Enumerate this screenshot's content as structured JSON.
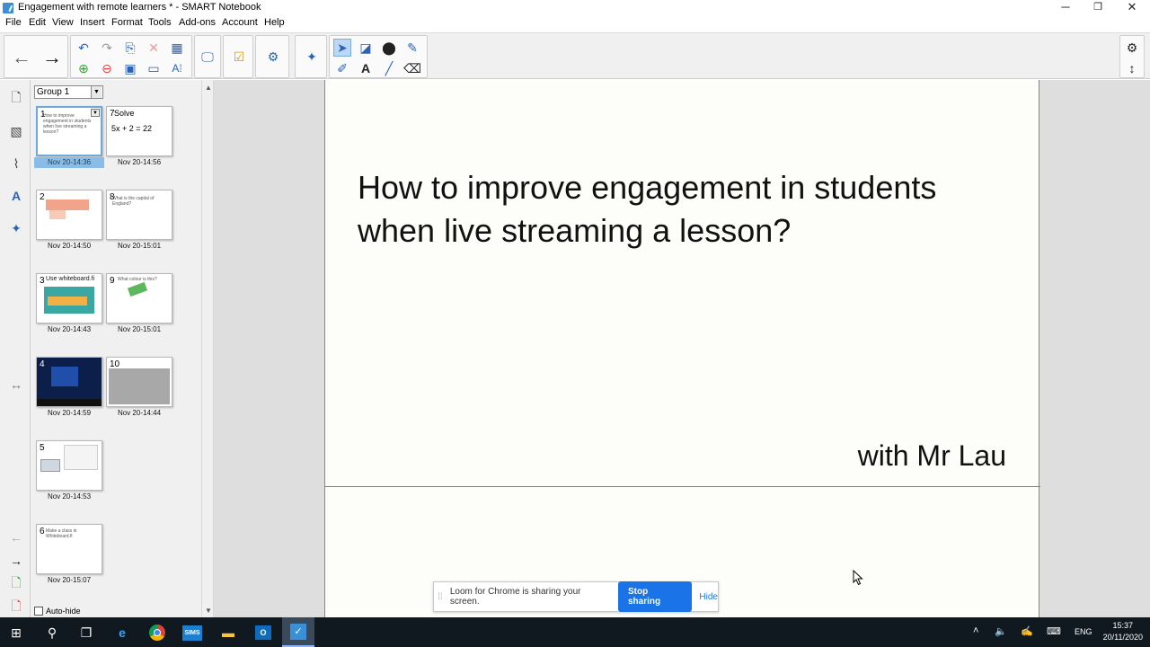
{
  "window": {
    "title": "Engagement with remote learners * - SMART Notebook",
    "minimize": "─",
    "restore": "❐",
    "close": "✕"
  },
  "menu": [
    "File",
    "Edit",
    "View",
    "Insert",
    "Format",
    "Tools",
    "Add-ons",
    "Account",
    "Help"
  ],
  "sorter": {
    "group_label": "Group 1",
    "autohide_label": "Auto-hide",
    "thumbs": [
      {
        "num": "1",
        "date": "Nov 20-14:36",
        "text": "How to improve engagement in students when live streaming a lesson?",
        "selected": true
      },
      {
        "num": "7",
        "date": "Nov 20-14:56",
        "text": "Solve",
        "extra": "5x + 2 = 22"
      },
      {
        "num": "2",
        "date": "Nov 20-14:50",
        "text": ""
      },
      {
        "num": "8",
        "date": "Nov 20-15:01",
        "text": "What is the capital of England?"
      },
      {
        "num": "3",
        "date": "Nov 20-14:43",
        "text": "Use whiteboard.fi"
      },
      {
        "num": "9",
        "date": "Nov 20-15:01",
        "text": "What colour is this?"
      },
      {
        "num": "4",
        "date": "Nov 20-14:59",
        "text": ""
      },
      {
        "num": "10",
        "date": "Nov 20-14:44",
        "text": ""
      },
      {
        "num": "5",
        "date": "Nov 20-14:53",
        "text": ""
      },
      {
        "num": "6",
        "date": "Nov 20-15:07",
        "text": "Make a class in Whiteboard.fi"
      }
    ]
  },
  "slide": {
    "title": "How to improve engagement in students when live streaming a lesson?",
    "subtitle": "with Mr Lau"
  },
  "loom": {
    "message": "Loom for Chrome is sharing your screen.",
    "stop_label": "Stop sharing",
    "hide_label": "Hide"
  },
  "taskbar": {
    "sims_label": "SIMS",
    "lang": "ENG",
    "time": "15:37",
    "date": "20/11/2020"
  },
  "colors": {
    "accent": "#1b73e8",
    "selection": "#89bde8",
    "taskbar": "#101820"
  }
}
